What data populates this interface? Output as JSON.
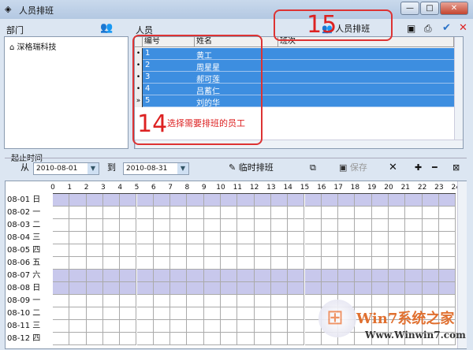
{
  "window": {
    "title": "人员排班",
    "controls": [
      "—",
      "□",
      "✕"
    ]
  },
  "left": {
    "label": "部门",
    "tree": [
      {
        "label": "深格瑞科技"
      }
    ]
  },
  "people": {
    "label": "人员",
    "schedule_button": "人员排班",
    "columns": [
      "编号",
      "姓名",
      "班次"
    ],
    "rows": [
      {
        "ind": "•",
        "id": "1",
        "name": "黄工",
        "shift": ""
      },
      {
        "ind": "•",
        "id": "2",
        "name": "周星星",
        "shift": ""
      },
      {
        "ind": "•",
        "id": "3",
        "name": "郝可莲",
        "shift": ""
      },
      {
        "ind": "•",
        "id": "4",
        "name": "吕蓄仁",
        "shift": ""
      },
      {
        "ind": "»",
        "id": "5",
        "name": "刘的华",
        "shift": ""
      }
    ]
  },
  "annotations": {
    "step14_num": "14",
    "step14_text": "选择需要排班的员工",
    "step15_num": "15"
  },
  "range": {
    "label": "起止时间",
    "from_label": "从",
    "from": "2010-08-01",
    "to_label": "到",
    "to": "2010-08-31"
  },
  "toolbar": {
    "temp_schedule": "临时排班",
    "save": "保存"
  },
  "grid": {
    "hours": [
      "0",
      "1",
      "2",
      "3",
      "4",
      "5",
      "6",
      "7",
      "8",
      "9",
      "10",
      "11",
      "12",
      "13",
      "14",
      "15",
      "16",
      "17",
      "18",
      "19",
      "20",
      "21",
      "22",
      "23",
      "24"
    ],
    "days": [
      {
        "date": "08-01",
        "wd": "日",
        "hl": true
      },
      {
        "date": "08-02",
        "wd": "一",
        "hl": false
      },
      {
        "date": "08-03",
        "wd": "二",
        "hl": false
      },
      {
        "date": "08-04",
        "wd": "三",
        "hl": false
      },
      {
        "date": "08-05",
        "wd": "四",
        "hl": false
      },
      {
        "date": "08-06",
        "wd": "五",
        "hl": false
      },
      {
        "date": "08-07",
        "wd": "六",
        "hl": true
      },
      {
        "date": "08-08",
        "wd": "日",
        "hl": true
      },
      {
        "date": "08-09",
        "wd": "一",
        "hl": false
      },
      {
        "date": "08-10",
        "wd": "二",
        "hl": false
      },
      {
        "date": "08-11",
        "wd": "三",
        "hl": false
      },
      {
        "date": "08-12",
        "wd": "四",
        "hl": false
      }
    ],
    "highlight_color": "#c8c8ec"
  },
  "watermark": {
    "brand": "Win7系统之家",
    "url": "Www.Winwin7.com"
  }
}
